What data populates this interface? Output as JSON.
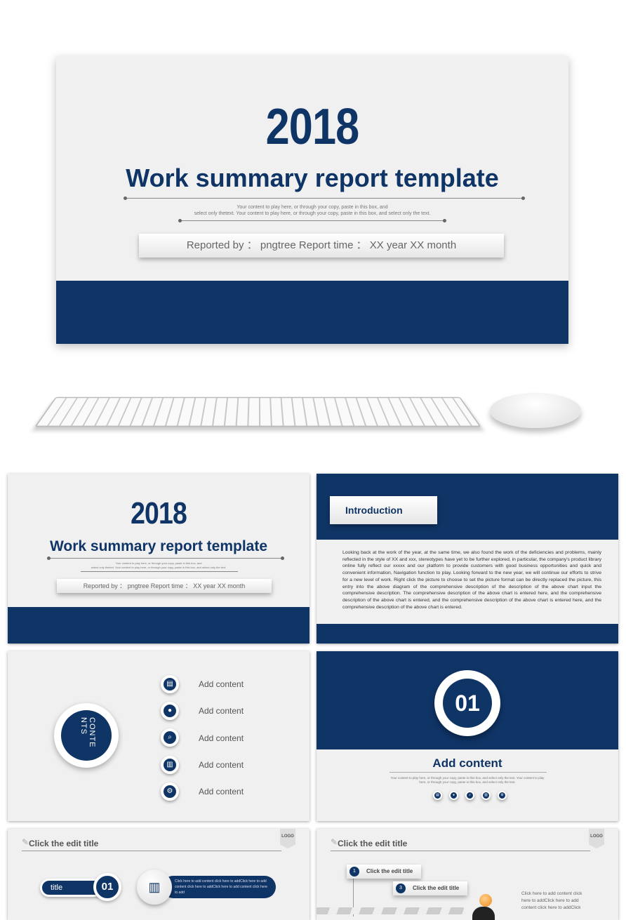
{
  "colors": {
    "navy": "#0f3466",
    "background": "#f0f0f0"
  },
  "cover": {
    "year": "2018",
    "title": "Work summary report template",
    "subtitle_line1": "Your content to play here, or through your copy, paste in this box, and",
    "subtitle_line2": "select only thetext. Your content to play here, or through your copy, paste in this box, and select only the text.",
    "reporter": "Reported by ： pngtree    Report time ： XX year XX month"
  },
  "intro": {
    "heading": "Introduction",
    "body": "Looking back at the work of the year, at the same time, we also found the work of the deficiencies and problems, mainly reflected in the style of XX and xxx, stereotypes have yet to be further explored, in particular, the company's product library online fully reflect our xxxxx and our platform to provide customers with good business opportunities and quick and convenient information, Navigation function to play.  Looking forward to the new year, we will continue our efforts to strive for a new level of work. Right click the picture to choose to set the picture format can be directly replaced the picture, this entry into the above diagram of the comprehensive description of the description of the above chart input the comprehensive description. The comprehensive description of the above chart is entered here, and the comprehensive description of the above chart is entered, and the comprehensive description of the above chart is entered here, and the comprehensive description of the above chart is entered."
  },
  "contents": {
    "badge": "CONTENTS",
    "items": [
      {
        "label": "Add content",
        "icon": "clipboard-icon"
      },
      {
        "label": "Add content",
        "icon": "user-icon"
      },
      {
        "label": "Add content",
        "icon": "search-icon"
      },
      {
        "label": "Add content",
        "icon": "chart-icon"
      },
      {
        "label": "Add content",
        "icon": "user-settings-icon"
      }
    ]
  },
  "section": {
    "number": "01",
    "title": "Add content",
    "desc_line1": "Your content to play here, or through your copy, paste in this box, and select only the text. Your content to play",
    "desc_line2": "here, or through your copy, paste in this box, and select only the text."
  },
  "slide5": {
    "header": "Click the edit title",
    "logo": "LOGO",
    "tag": "title",
    "number": "01",
    "body": "Click here to add content click here to addClick here to add content click here to addClick here to add content click here to add"
  },
  "slide6": {
    "header": "Click the edit title",
    "logo": "LOGO",
    "step1_num": "1",
    "step1": "Click the edit title",
    "step3_num": "3",
    "step3": "Click the edit title",
    "side_text": "Click here to add content click here to addClick here to add content click here to addClick"
  }
}
